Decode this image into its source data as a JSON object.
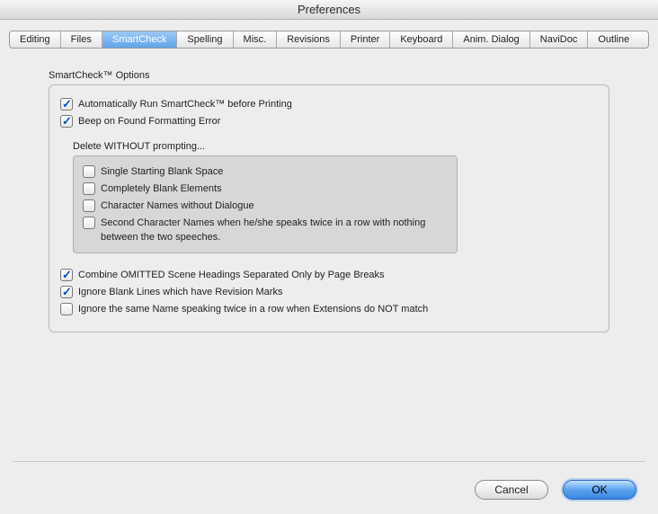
{
  "title": "Preferences",
  "tabs": [
    "Editing",
    "Files",
    "SmartCheck",
    "Spelling",
    "Misc.",
    "Revisions",
    "Printer",
    "Keyboard",
    "Anim. Dialog",
    "NaviDoc",
    "Outline"
  ],
  "activeTab": 2,
  "options": {
    "groupLabel": "SmartCheck™ Options",
    "autoRun": {
      "label": "Automatically Run SmartCheck™ before Printing",
      "checked": true
    },
    "beep": {
      "label": "Beep on Found Formatting Error",
      "checked": true
    },
    "deleteLabel": "Delete WITHOUT prompting...",
    "delete": {
      "blankSpace": {
        "label": "Single Starting Blank Space",
        "checked": false
      },
      "blankElements": {
        "label": "Completely Blank Elements",
        "checked": false
      },
      "charNoDialogue": {
        "label": "Character Names without Dialogue",
        "checked": false
      },
      "secondChar": {
        "label": "Second Character Names when he/she speaks twice in a row with nothing between the two speeches.",
        "checked": false
      }
    },
    "combine": {
      "label": "Combine OMITTED Scene Headings Separated Only by Page Breaks",
      "checked": true
    },
    "ignoreRev": {
      "label": "Ignore Blank Lines which have Revision Marks",
      "checked": true
    },
    "ignoreExt": {
      "label": "Ignore the same Name speaking twice in a row when Extensions do NOT match",
      "checked": false
    }
  },
  "buttons": {
    "cancel": "Cancel",
    "ok": "OK"
  }
}
